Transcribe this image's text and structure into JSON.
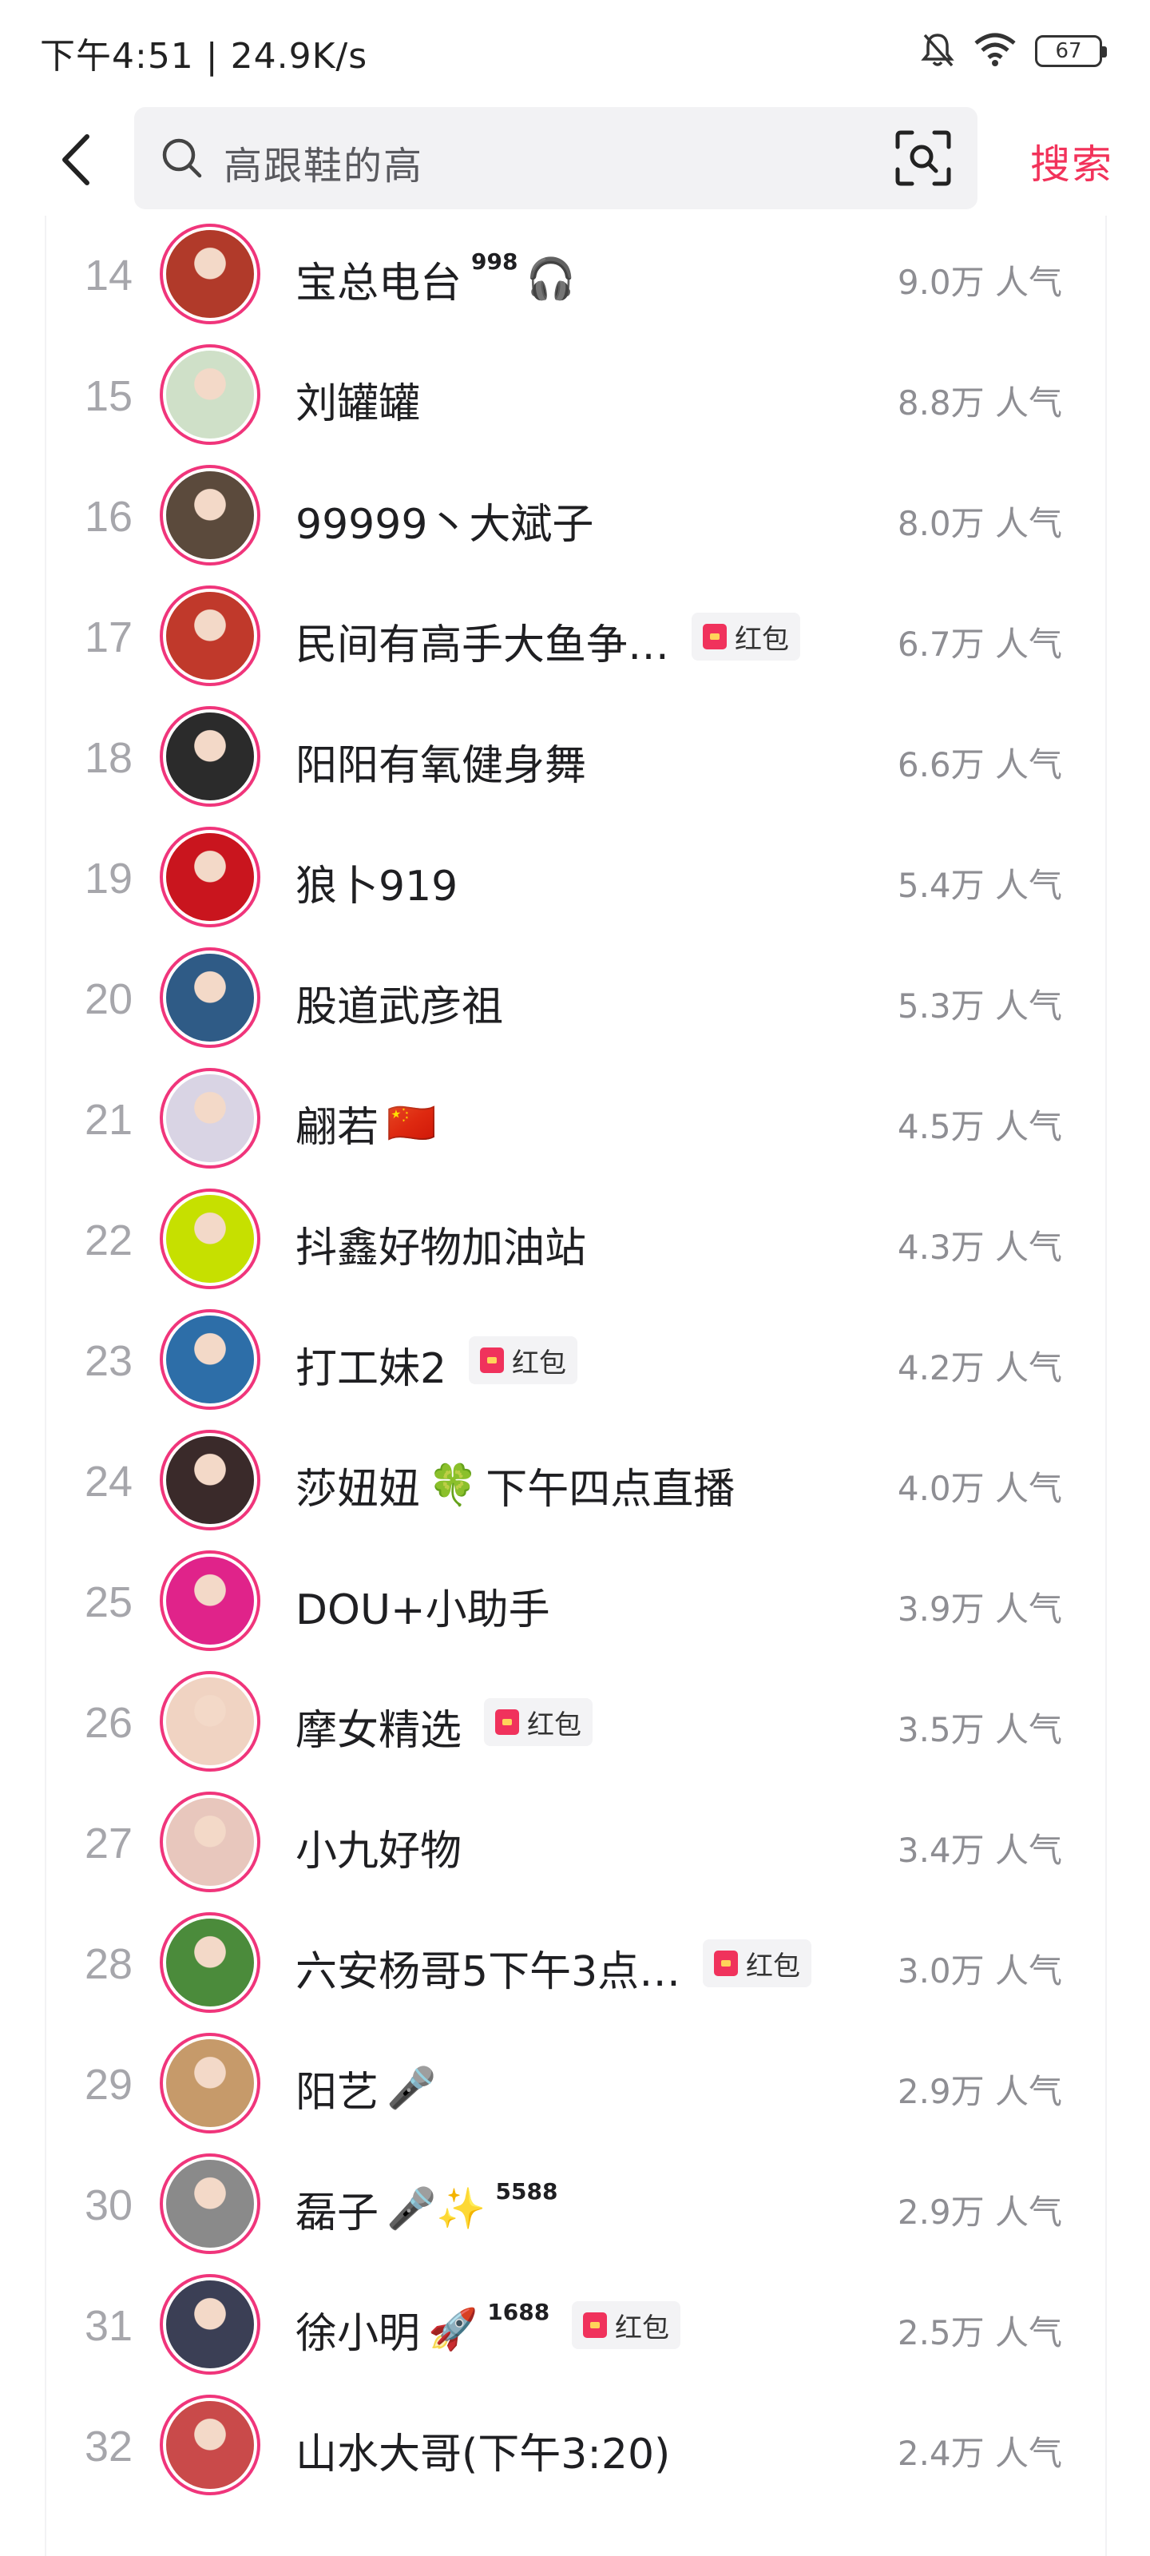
{
  "status_bar": {
    "time_text": "下午4:51 | 24.9K/s",
    "battery_level": "67"
  },
  "search": {
    "query": "高跟鞋的高",
    "action_label": "搜索"
  },
  "hongbao_label": "红包",
  "rows": [
    {
      "rank": "14",
      "name": "宝总电台",
      "sup": "998",
      "emoji": "🎧",
      "hongbao": false,
      "popularity": "9.0万 人气",
      "color": "#b13a2a"
    },
    {
      "rank": "15",
      "name": "刘罐罐",
      "sup": "",
      "emoji": "",
      "hongbao": false,
      "popularity": "8.8万 人气",
      "color": "#cfe0c8"
    },
    {
      "rank": "16",
      "name": "99999丶大斌子",
      "sup": "",
      "emoji": "",
      "hongbao": false,
      "popularity": "8.0万 人气",
      "color": "#5b4a3c"
    },
    {
      "rank": "17",
      "name": "民间有高手大鱼争…",
      "sup": "",
      "emoji": "",
      "hongbao": true,
      "popularity": "6.7万 人气",
      "color": "#c0392b"
    },
    {
      "rank": "18",
      "name": "阳阳有氧健身舞",
      "sup": "",
      "emoji": "",
      "hongbao": false,
      "popularity": "6.6万 人气",
      "color": "#2b2b2b"
    },
    {
      "rank": "19",
      "name": "狼卜919",
      "sup": "",
      "emoji": "",
      "hongbao": false,
      "popularity": "5.4万 人气",
      "color": "#c9151e"
    },
    {
      "rank": "20",
      "name": "股道武彦祖",
      "sup": "",
      "emoji": "",
      "hongbao": false,
      "popularity": "5.3万 人气",
      "color": "#2f5b86"
    },
    {
      "rank": "21",
      "name": "翩若",
      "sup": "",
      "emoji": "🇨🇳",
      "hongbao": false,
      "popularity": "4.5万 人气",
      "color": "#d9d4e4"
    },
    {
      "rank": "22",
      "name": "抖鑫好物加油站",
      "sup": "",
      "emoji": "",
      "hongbao": false,
      "popularity": "4.3万 人气",
      "color": "#c6e000"
    },
    {
      "rank": "23",
      "name": "打工妹2",
      "sup": "",
      "emoji": "",
      "hongbao": true,
      "popularity": "4.2万 人气",
      "color": "#2d6ea8"
    },
    {
      "rank": "24",
      "name": "莎妞妞",
      "sup": "",
      "emoji": "🍀",
      "suffix": "下午四点直播",
      "hongbao": false,
      "popularity": "4.0万 人气",
      "color": "#3a2a2a"
    },
    {
      "rank": "25",
      "name": "DOU+小助手",
      "sup": "",
      "emoji": "",
      "hongbao": false,
      "popularity": "3.9万 人气",
      "color": "#e0238a"
    },
    {
      "rank": "26",
      "name": "摩女精选",
      "sup": "",
      "emoji": "",
      "hongbao": true,
      "popularity": "3.5万 人气",
      "color": "#f0d3c2"
    },
    {
      "rank": "27",
      "name": "小九好物",
      "sup": "",
      "emoji": "",
      "hongbao": false,
      "popularity": "3.4万 人气",
      "color": "#e8c7bd"
    },
    {
      "rank": "28",
      "name": "六安杨哥5下午3点…",
      "sup": "",
      "emoji": "",
      "hongbao": true,
      "popularity": "3.0万 人气",
      "color": "#4b8b3b"
    },
    {
      "rank": "29",
      "name": "阳艺",
      "sup": "",
      "emoji": "🎤",
      "hongbao": false,
      "popularity": "2.9万 人气",
      "color": "#c69a6a"
    },
    {
      "rank": "30",
      "name": "磊子",
      "sup": "5588",
      "emoji": "🎤✨",
      "hongbao": false,
      "popularity": "2.9万 人气",
      "color": "#8a8a8a"
    },
    {
      "rank": "31",
      "name": "徐小明",
      "sup": "1688",
      "emoji": "🚀",
      "hongbao": true,
      "popularity": "2.5万 人气",
      "color": "#3b3f55"
    },
    {
      "rank": "32",
      "name": "山水大哥(下午3:20)",
      "sup": "",
      "emoji": "",
      "hongbao": false,
      "popularity": "2.4万 人气",
      "color": "#c94a4a"
    }
  ]
}
